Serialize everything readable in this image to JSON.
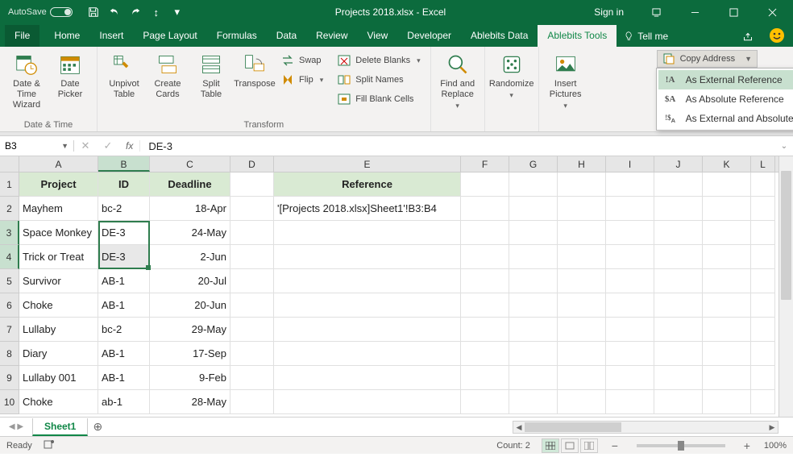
{
  "titlebar": {
    "autosave": "AutoSave",
    "title": "Projects 2018.xlsx - Excel",
    "signin": "Sign in"
  },
  "tabs": {
    "file": "File",
    "home": "Home",
    "insert": "Insert",
    "pagelayout": "Page Layout",
    "formulas": "Formulas",
    "data": "Data",
    "review": "Review",
    "view": "View",
    "developer": "Developer",
    "abdata": "Ablebits Data",
    "abtools": "Ablebits Tools",
    "tellme": "Tell me"
  },
  "ribbon": {
    "datetime": "Date & Time",
    "datetime_wizard": "Date & Time Wizard",
    "datepicker": "Date Picker",
    "transform": "Transform",
    "unpivot": "Unpivot Table",
    "createcards": "Create Cards",
    "splittable": "Split Table",
    "transpose": "Transpose",
    "swap": "Swap",
    "flip": "Flip",
    "deleteblanks": "Delete Blanks",
    "splitnames": "Split Names",
    "fillblank": "Fill Blank Cells",
    "findreplace": "Find and Replace",
    "randomize": "Randomize",
    "insertpics": "Insert Pictures",
    "copyaddr": "Copy Address",
    "menu1": "As External Reference",
    "menu2": "As Absolute Reference",
    "menu3": "As External and Absolute Reference"
  },
  "formula": {
    "namebox": "B3",
    "value": "DE-3"
  },
  "cols": [
    "A",
    "B",
    "C",
    "D",
    "E",
    "F",
    "G",
    "H",
    "I",
    "J",
    "K",
    "L"
  ],
  "headers": {
    "A": "Project",
    "B": "ID",
    "C": "Deadline",
    "E": "Reference"
  },
  "rows": [
    {
      "n": "2",
      "A": "Mayhem",
      "B": "bc-2",
      "C": "18-Apr",
      "E": "'[Projects 2018.xlsx]Sheet1'!B3:B4"
    },
    {
      "n": "3",
      "A": "Space Monkey",
      "B": "DE-3",
      "C": "24-May"
    },
    {
      "n": "4",
      "A": "Trick or Treat",
      "B": "DE-3",
      "C": "2-Jun"
    },
    {
      "n": "5",
      "A": "Survivor",
      "B": "AB-1",
      "C": "20-Jul"
    },
    {
      "n": "6",
      "A": "Choke",
      "B": "AB-1",
      "C": "20-Jun"
    },
    {
      "n": "7",
      "A": "Lullaby",
      "B": "bc-2",
      "C": "29-May"
    },
    {
      "n": "8",
      "A": "Diary",
      "B": "AB-1",
      "C": "17-Sep"
    },
    {
      "n": "9",
      "A": "Lullaby 001",
      "B": "AB-1",
      "C": "9-Feb"
    },
    {
      "n": "10",
      "A": "Choke",
      "B": "ab-1",
      "C": "28-May"
    }
  ],
  "sheet": {
    "tab1": "Sheet1"
  },
  "status": {
    "ready": "Ready",
    "count": "Count: 2",
    "zoom": "100%"
  }
}
